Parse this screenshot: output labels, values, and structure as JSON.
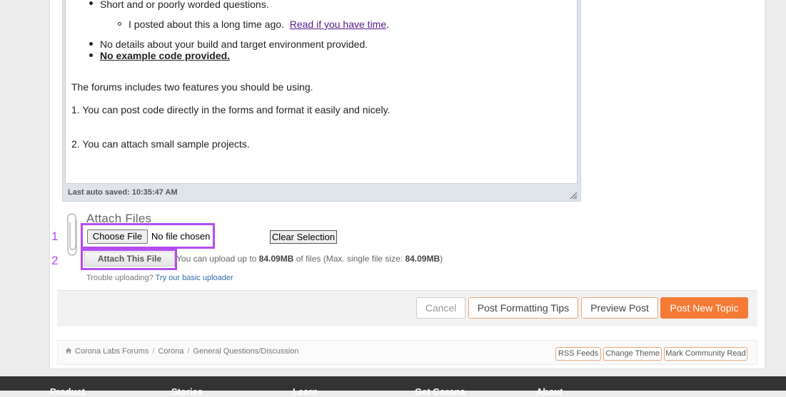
{
  "editor": {
    "bullets": [
      "Short and or poorly worded questions.",
      "No details about your build and target environment provided.",
      "No example code provided."
    ],
    "sub_bullet_text": "I posted about this a long time ago.",
    "sub_bullet_link": "Read if you have time",
    "sub_bullet_period": ".",
    "para1": "The forums includes two features you should be using.",
    "para2": "1. You can post code directly in the forms and format it easily and nicely.",
    "para3": "2. You can attach small sample projects.",
    "autosave": "Last auto saved: 10:35:47 AM"
  },
  "attach": {
    "title": "Attach Files",
    "choose_label": "Choose File",
    "no_file": "No file chosen",
    "clear_label": "Clear Selection",
    "attach_label": "Attach This File",
    "upload_pre": "You can upload up to ",
    "upload_size": "84.09MB",
    "upload_mid": " of files (Max. single file size: ",
    "upload_max": "84.09MB",
    "upload_post": ")",
    "trouble_text": "Trouble uploading?",
    "trouble_link": "Try our basic uploader"
  },
  "annotations": {
    "one": "1",
    "two": "2",
    "highlight_color": "#b44cf0"
  },
  "actions": {
    "cancel": "Cancel",
    "tips": "Post Formatting Tips",
    "preview": "Preview Post",
    "post": "Post New Topic",
    "accent": "#f57a35"
  },
  "breadcrumb": {
    "items": [
      "Corona Labs Forums",
      "Corona",
      "General Questions/Discussion"
    ],
    "separator": "/"
  },
  "tags": {
    "rss": "RSS Feeds",
    "theme": "Change Theme",
    "mark": "Mark Community Read"
  },
  "footer": {
    "items": [
      "Product",
      "Stories",
      "Learn",
      "Get Corona",
      "About"
    ]
  }
}
